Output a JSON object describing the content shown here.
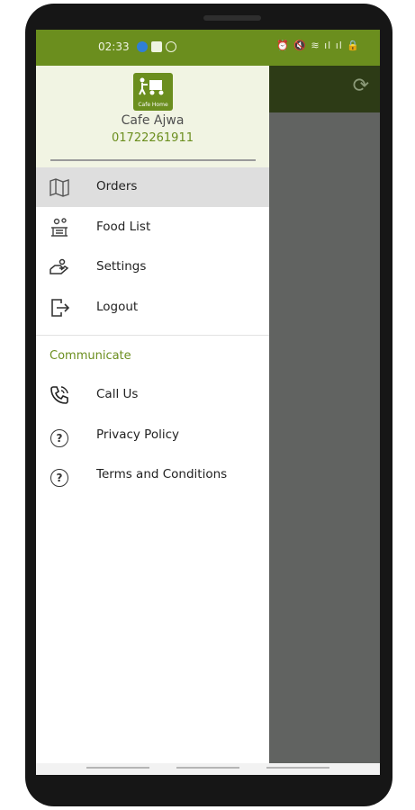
{
  "status_bar": {
    "time": "02:33",
    "icons": [
      "notification-icon",
      "sim-icon",
      "account-icon"
    ]
  },
  "profile": {
    "logo_text": "Cafe Home",
    "name": "Cafe Ajwa",
    "phone": "01722261911"
  },
  "menu": {
    "items": [
      {
        "label": "Orders",
        "icon": "map-icon",
        "active": true
      },
      {
        "label": "Food List",
        "icon": "food-list-icon",
        "active": false
      },
      {
        "label": "Settings",
        "icon": "settings-hand-icon",
        "active": false
      },
      {
        "label": "Logout",
        "icon": "logout-icon",
        "active": false
      }
    ]
  },
  "communicate": {
    "title": "Communicate",
    "items": [
      {
        "label": "Call Us",
        "icon": "phone-icon"
      },
      {
        "label": "Privacy Policy",
        "icon": "question-icon"
      },
      {
        "label": "Terms and Conditions",
        "icon": "question-icon"
      }
    ]
  },
  "colors": {
    "primary": "#6b8e1e",
    "toolbar_dark": "#2d3b16",
    "scrim": "#616361",
    "active_bg": "#dedede"
  }
}
